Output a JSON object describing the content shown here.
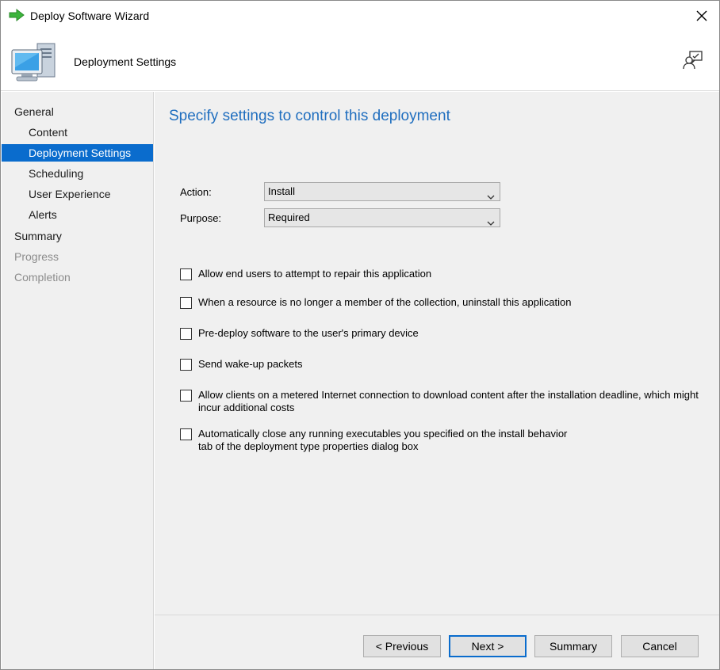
{
  "window": {
    "title": "Deploy Software Wizard"
  },
  "banner": {
    "page_name": "Deployment Settings"
  },
  "nav": {
    "items": [
      {
        "label": "General",
        "level": 1,
        "state": "normal"
      },
      {
        "label": "Content",
        "level": 2,
        "state": "normal"
      },
      {
        "label": "Deployment Settings",
        "level": 2,
        "state": "selected"
      },
      {
        "label": "Scheduling",
        "level": 2,
        "state": "normal"
      },
      {
        "label": "User Experience",
        "level": 2,
        "state": "normal"
      },
      {
        "label": "Alerts",
        "level": 2,
        "state": "normal"
      },
      {
        "label": "Summary",
        "level": 1,
        "state": "normal"
      },
      {
        "label": "Progress",
        "level": 1,
        "state": "disabled"
      },
      {
        "label": "Completion",
        "level": 1,
        "state": "disabled"
      }
    ]
  },
  "main": {
    "heading": "Specify settings to control this deployment",
    "action": {
      "label": "Action:",
      "value": "Install"
    },
    "purpose": {
      "label": "Purpose:",
      "value": "Required"
    },
    "options": [
      {
        "label": "Allow end users to attempt to repair this application",
        "checked": false
      },
      {
        "label": "When a resource is no longer a member of the collection, uninstall this application",
        "checked": false
      },
      {
        "label": "Pre-deploy software to the user's primary device",
        "checked": false
      },
      {
        "label": "Send wake-up packets",
        "checked": false
      },
      {
        "label": "Allow clients on a metered Internet connection to download content after the installation deadline, which might incur additional costs",
        "checked": false
      },
      {
        "label": "Automatically close any running executables you specified on the install behavior tab of the deployment type properties dialog box",
        "checked": false
      }
    ]
  },
  "footer": {
    "previous": "< Previous",
    "next": "Next >",
    "summary": "Summary",
    "cancel": "Cancel"
  },
  "colors": {
    "accent": "#0a6ccd",
    "heading": "#1f6ebf",
    "panel": "#f0f0f0"
  },
  "icons": [
    "green-arrow-icon",
    "close-icon",
    "computer-icon",
    "feedback-icon",
    "chevron-down-icon"
  ]
}
